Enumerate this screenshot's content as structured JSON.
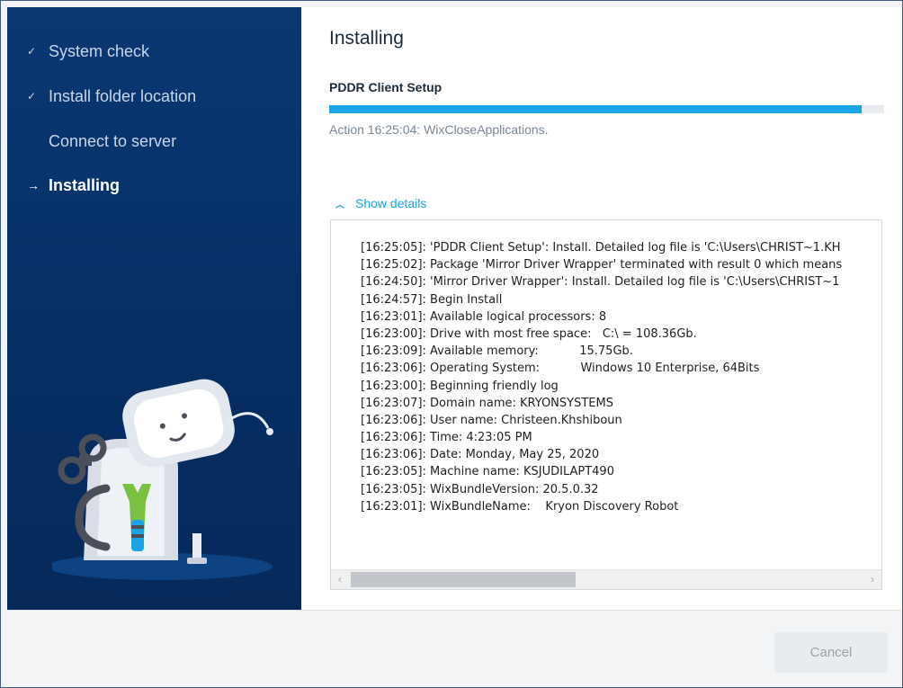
{
  "sidebar": {
    "steps": [
      {
        "label": "System check",
        "state": "done",
        "mark": "✓"
      },
      {
        "label": "Install folder location",
        "state": "done",
        "mark": "✓"
      },
      {
        "label": "Connect to server",
        "state": "pending",
        "mark": ""
      },
      {
        "label": "Installing",
        "state": "active",
        "mark": "→"
      }
    ]
  },
  "main": {
    "title": "Installing",
    "subtitle": "PDDR Client Setup",
    "progress": 0.96,
    "status": "Action 16:25:04: WixCloseApplications.",
    "details_toggle": "Show details",
    "details_icon": "chevron-up-icon",
    "log": [
      "[16:25:05]: 'PDDR Client Setup': Install. Detailed log file is 'C:\\Users\\CHRIST~1.KH",
      "[16:25:02]: Package 'Mirror Driver Wrapper' terminated with result 0 which means",
      "[16:24:50]: 'Mirror Driver Wrapper': Install. Detailed log file is 'C:\\Users\\CHRIST~1",
      "[16:24:57]: Begin Install",
      "[16:23:01]: Available logical processors: 8",
      "[16:23:00]: Drive with most free space:   C:\\ = 108.36Gb.",
      "[16:23:09]: Available memory:           15.75Gb.",
      "[16:23:06]: Operating System:           Windows 10 Enterprise, 64Bits",
      "[16:23:00]: Beginning friendly log",
      "[16:23:07]: Domain name: KRYONSYSTEMS",
      "[16:23:06]: User name: Christeen.Khshiboun",
      "[16:23:06]: Time: 4:23:05 PM",
      "[16:23:06]: Date: Monday, May 25, 2020",
      "[16:23:05]: Machine name: KSJUDILAPT490",
      "[16:23:05]: WixBundleVersion: 20.5.0.32",
      "[16:23:01]: WixBundleName:    Kryon Discovery Robot"
    ]
  },
  "footer": {
    "cancel_label": "Cancel"
  },
  "colors": {
    "sidebar_bg": "#08356d",
    "accent": "#1aa4e6",
    "robot_wrench": "#7ac142"
  }
}
